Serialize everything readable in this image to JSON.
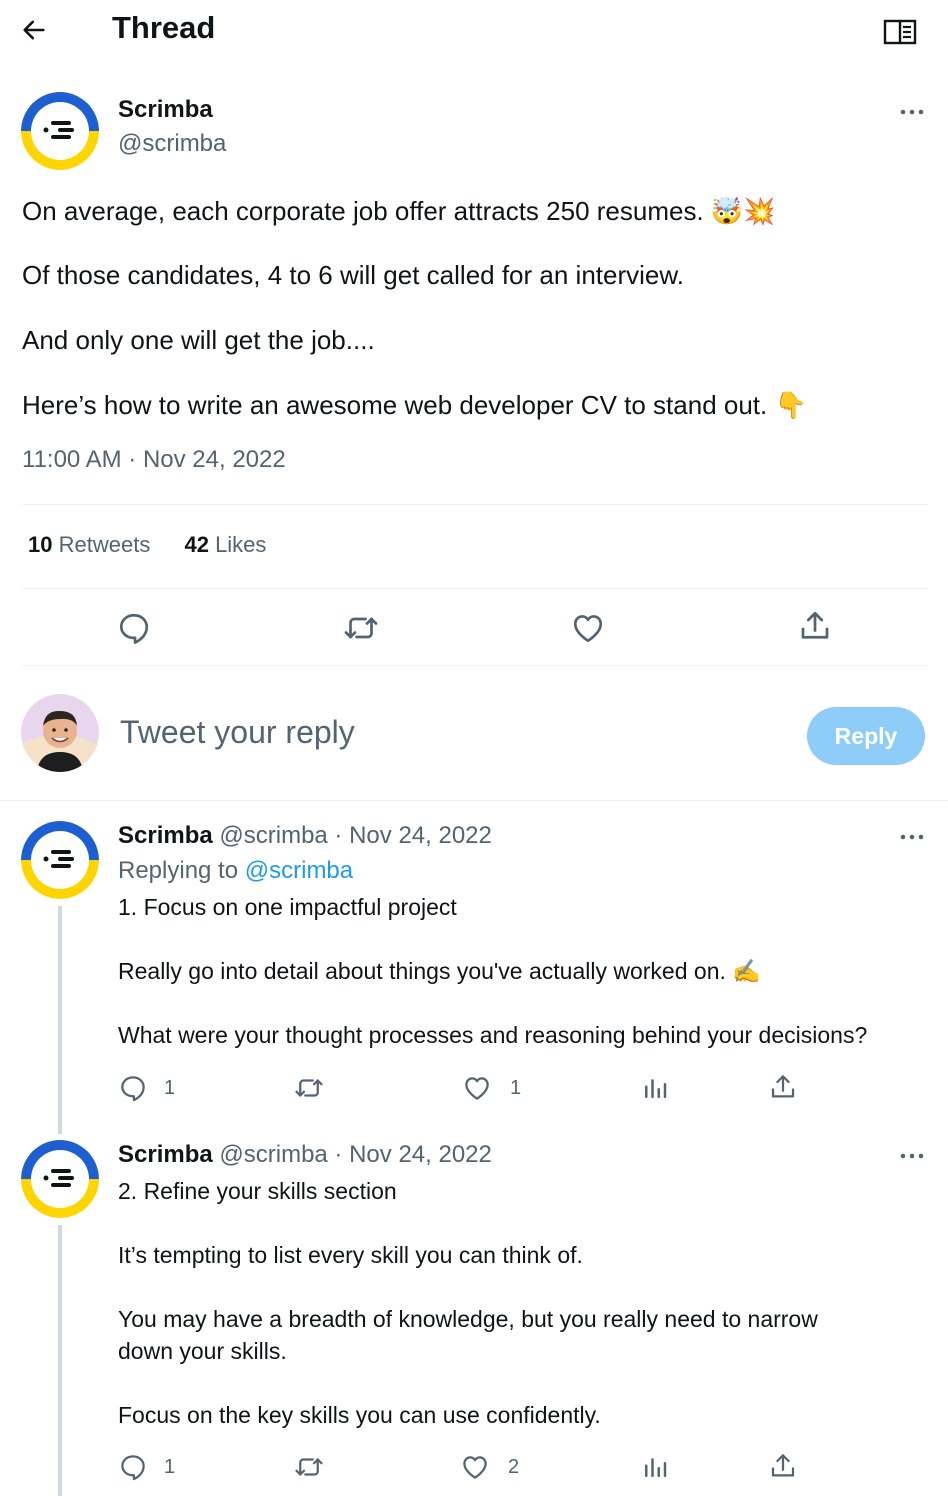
{
  "header": {
    "title": "Thread"
  },
  "main_tweet": {
    "author_name": "Scrimba",
    "author_handle": "@scrimba",
    "lines": [
      "On average, each corporate job offer attracts 250 resumes. 🤯💥",
      "Of those candidates, 4 to 6 will get called for an interview.",
      "And only one will get the job....",
      "Here’s how to write an awesome web developer CV to stand out. 👇"
    ],
    "timestamp": "11:00 AM · Nov 24, 2022",
    "retweets_count": "10",
    "retweets_label": "Retweets",
    "likes_count": "42",
    "likes_label": "Likes"
  },
  "reply_box": {
    "placeholder": "Tweet your reply",
    "button_label": "Reply"
  },
  "replies": [
    {
      "author_name": "Scrimba",
      "meta": "@scrimba · Nov 24, 2022",
      "replying_prefix": "Replying to",
      "replying_handle": "@scrimba",
      "lines": [
        "1. Focus on one impactful project",
        "Really go into detail about things you've actually worked on. ✍️",
        "What were your thought processes and reasoning behind your decisions?"
      ],
      "reply_count": "1",
      "like_count": "1"
    },
    {
      "author_name": "Scrimba",
      "meta": "@scrimba · Nov 24, 2022",
      "lines": [
        "2. Refine your skills section",
        "It’s tempting to list every skill you can think of.",
        "You may have a breadth of knowledge, but you really need to narrow down your skills.",
        "Focus on the key skills you can use confidently."
      ],
      "reply_count": "1",
      "like_count": "2"
    }
  ],
  "colors": {
    "text": "#0f1419",
    "secondary": "#536471",
    "link": "#1d9bf0",
    "reply_button": "#8ecdf8",
    "logo_blue": "#1d5fd1",
    "logo_yellow": "#ffd500"
  }
}
